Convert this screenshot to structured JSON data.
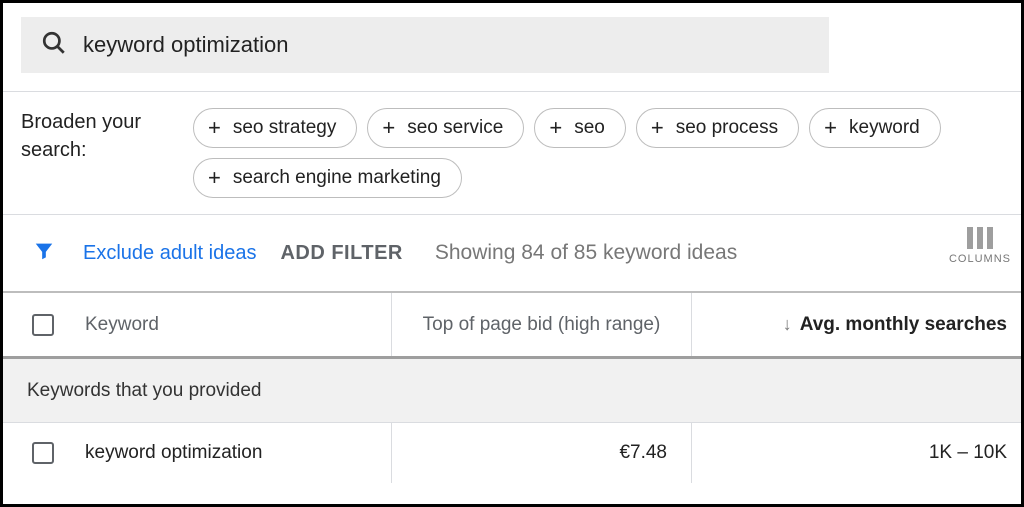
{
  "search": {
    "value": "keyword optimization"
  },
  "broaden": {
    "label": "Broaden your search:",
    "chips": [
      "seo strategy",
      "seo service",
      "seo",
      "seo process",
      "keyword",
      "search engine marketing"
    ]
  },
  "filters": {
    "exclude": "Exclude adult ideas",
    "add": "ADD FILTER",
    "showing": "Showing 84 of 85 keyword ideas",
    "columns": "COLUMNS"
  },
  "table": {
    "headers": {
      "keyword": "Keyword",
      "bid": "Top of page bid (high range)",
      "avg": "Avg. monthly searches"
    },
    "section": "Keywords that you provided",
    "rows": [
      {
        "keyword": "keyword optimization",
        "bid": "€7.48",
        "avg": "1K – 10K"
      }
    ]
  }
}
